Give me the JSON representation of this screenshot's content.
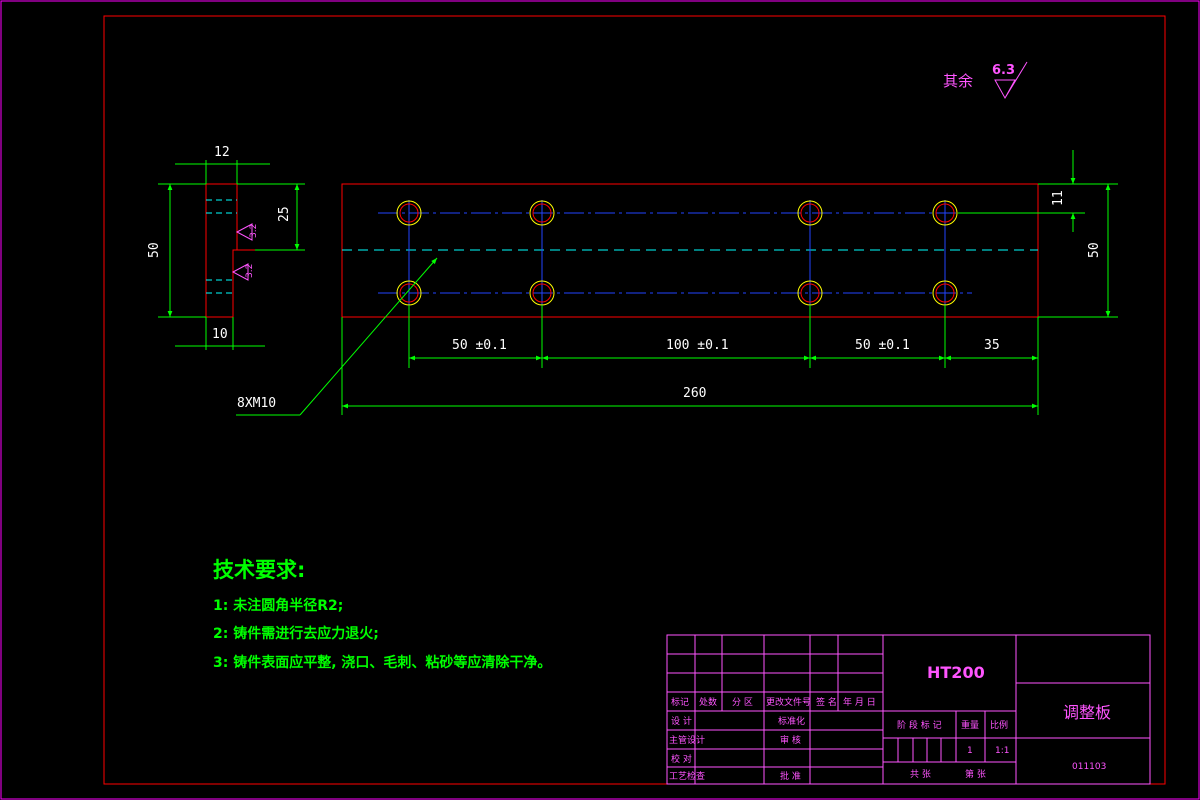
{
  "roughness": {
    "label": "其余",
    "value": "6.3"
  },
  "side_view": {
    "dim_width": "12",
    "dim_height": "50",
    "dim_half": "25",
    "dim_bottom": "10",
    "rough1": "3.2",
    "rough2": "3.2"
  },
  "main_view": {
    "dim_hole_offset": "11",
    "dim_height": "50",
    "dim_spacing_1": "50 ±0.1",
    "dim_spacing_2": "100 ±0.1",
    "dim_spacing_3": "50 ±0.1",
    "dim_end": "35",
    "dim_total": "260",
    "hole_callout": "8XM10"
  },
  "notes": {
    "title": "技术要求:",
    "items": [
      "1: 未注圆角半径R2;",
      "2: 铸件需进行去应力退火;",
      "3: 铸件表面应平整, 浇口、毛刺、粘砂等应清除干净。"
    ]
  },
  "title_block": {
    "material": "HT200",
    "part_name": "调整板",
    "drawing_no": "011103",
    "header_labels": [
      "标记",
      "处数",
      "分 区",
      "更改文件号",
      "签 名",
      "年 月 日"
    ],
    "row_labels": [
      "设 计",
      "主管设计",
      "校 对",
      "工艺检查"
    ],
    "mid_labels": [
      "标准化",
      "审 核",
      "批 准"
    ],
    "stage_label": "阶 段 标 记",
    "weight_label": "重量",
    "scale_label": "比例",
    "quantity": "1",
    "scale": "1:1",
    "sheets_label": "共 张",
    "sheet_label": "第 张"
  }
}
